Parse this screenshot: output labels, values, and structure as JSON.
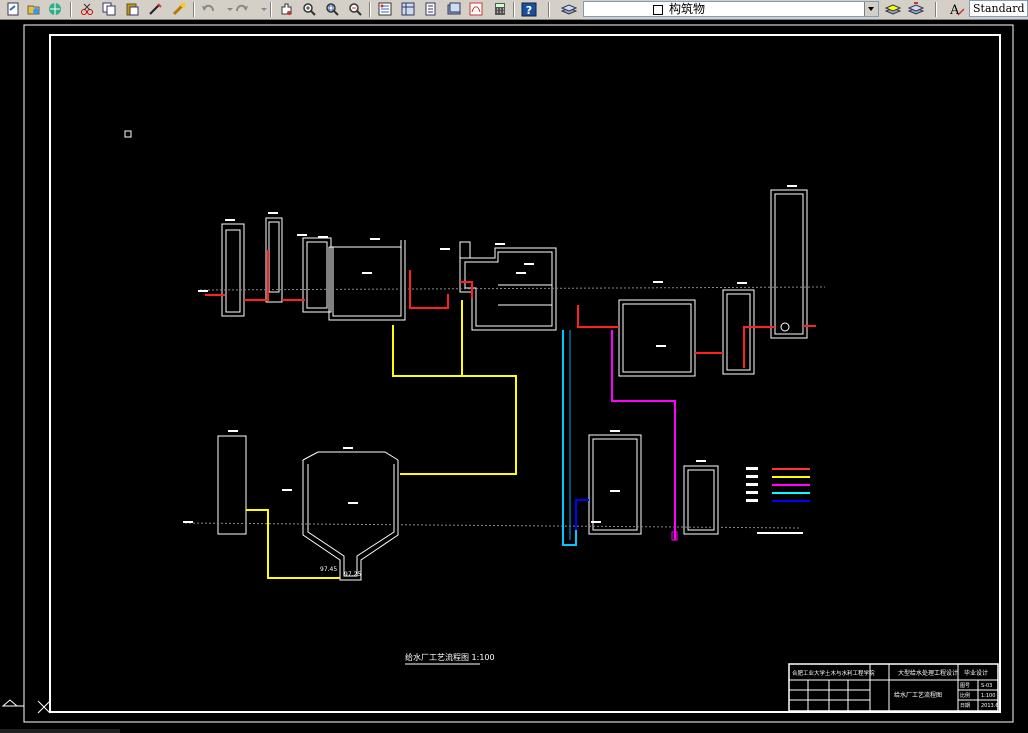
{
  "app": {
    "layer_name": "构筑物",
    "text_style": "Standard"
  },
  "toolbar": {
    "buttons": [
      "new-drawing-icon",
      "open-drawing-icon",
      "save-drawing-icon",
      "cut-icon",
      "copy-icon",
      "paste-icon",
      "match-properties-icon",
      "brush-icon",
      "undo-icon",
      "redo-icon",
      "pan-icon",
      "zoom-realtime-icon",
      "zoom-window-icon",
      "zoom-previous-icon",
      "properties-icon",
      "design-center-icon",
      "tool-palette-icon",
      "sheet-set-icon",
      "markup-icon",
      "calculator-icon",
      "help-icon",
      "layer-manager-icon",
      "layer-on-icon",
      "layer-freeze-icon",
      "layer-lock-icon",
      "layer-color-icon",
      "make-current-icon",
      "layer-previous-icon",
      "text-style-icon"
    ]
  },
  "drawing": {
    "title_text": "给水厂工艺流程图  1:100",
    "elevation_label_1": "97.45",
    "elevation_label_2": "97.25",
    "title_block": {
      "school": "合肥工业大学土木与水利工程学院",
      "project": "大型给水处理工程设计",
      "drawing_name": "给水厂工艺流程图",
      "stage": "毕业设计",
      "scale_label": "比例",
      "scale": "1:100",
      "sheet_label": "图号",
      "sheet": "S-03",
      "date_label": "日期",
      "date": "2013.6"
    },
    "legend_colors": [
      "#ff3333",
      "#ffff00",
      "#ff00ff",
      "#00ffff",
      "#0000ff"
    ]
  },
  "colors": {
    "background": "#000000",
    "frame": "#ffffff",
    "red": "#ff2020",
    "yellow": "#ffff00",
    "magenta": "#ff00ff",
    "cyan": "#00c8ff",
    "blue": "#0000ff",
    "toolbar": "#d4d0c8"
  }
}
